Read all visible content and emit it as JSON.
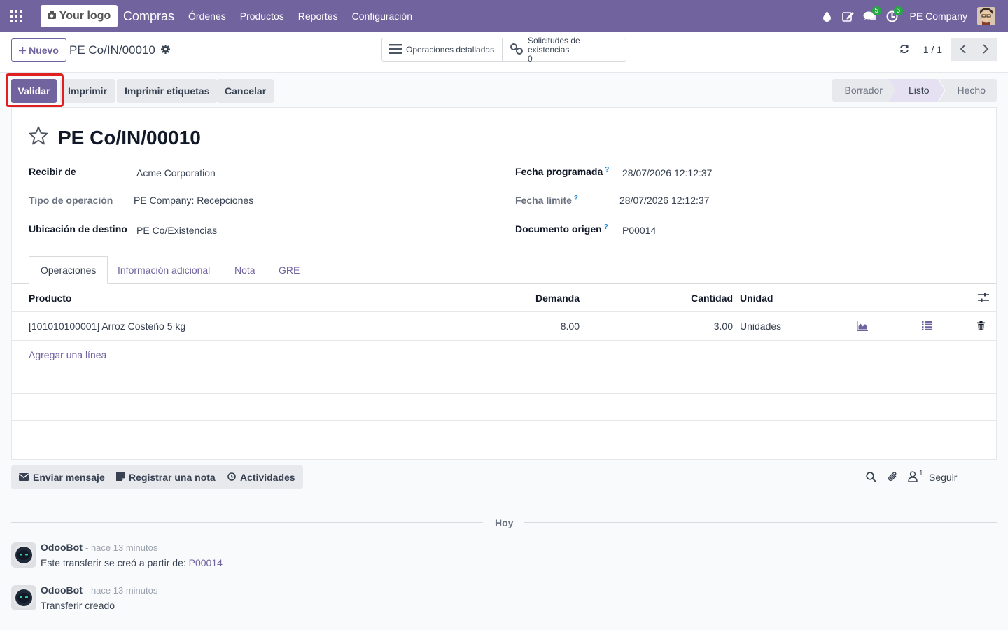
{
  "topbar": {
    "logo_label": "Your logo",
    "app_name": "Compras",
    "menu": [
      "Órdenes",
      "Productos",
      "Reportes",
      "Configuración"
    ],
    "messages_count": "5",
    "activities_count": "6",
    "company": "PE Company"
  },
  "control_panel": {
    "new_label": "Nuevo",
    "breadcrumb": "PE Co/IN/00010",
    "smart_buttons": [
      {
        "label": "Operaciones detalladas",
        "icon": "list-icon"
      },
      {
        "label": "Solicitudes de existencias",
        "value": "0",
        "icon": "link-icon"
      }
    ],
    "pager": "1 / 1"
  },
  "statusbar": {
    "buttons": [
      "Validar",
      "Imprimir",
      "Imprimir etiquetas",
      "Cancelar"
    ],
    "stages": [
      "Borrador",
      "Listo",
      "Hecho"
    ],
    "active_stage": "Listo"
  },
  "form": {
    "title": "PE Co/IN/00010",
    "fields": {
      "partner": {
        "label": "Recibir de",
        "value": "Acme Corporation"
      },
      "operation_type": {
        "label": "Tipo de operación",
        "value": "PE Company: Recepciones"
      },
      "dest_location": {
        "label": "Ubicación de destino",
        "value": "PE Co/Existencias"
      },
      "scheduled_date": {
        "label": "Fecha programada",
        "value": "28/07/2026 12:12:37"
      },
      "deadline": {
        "label": "Fecha límite",
        "value": "28/07/2026 12:12:37"
      },
      "origin": {
        "label": "Documento origen",
        "value": "P00014"
      }
    },
    "help_mark": "?",
    "tabs": [
      "Operaciones",
      "Información adicional",
      "Nota",
      "GRE"
    ],
    "table": {
      "columns": [
        "Producto",
        "Demanda",
        "Cantidad",
        "Unidad"
      ],
      "rows": [
        {
          "product": "[101010100001] Arroz Costeño 5 kg",
          "demand": "8.00",
          "quantity": "3.00",
          "uom": "Unidades"
        }
      ],
      "add_line": "Agregar una línea"
    }
  },
  "chatter": {
    "buttons": [
      "Enviar mensaje",
      "Registrar una nota",
      "Actividades"
    ],
    "followers_count": "1",
    "follow_label": "Seguir",
    "date_separator": "Hoy",
    "messages": [
      {
        "author": "OdooBot",
        "time": "- hace 13 minutos",
        "body": "Este transferir se creó a partir de: ",
        "link": "P00014"
      },
      {
        "author": "OdooBot",
        "time": "- hace 13 minutos",
        "body": "Transferir creado",
        "link": ""
      }
    ]
  },
  "colors": {
    "brand": "#71639e",
    "highlight": "#e02020",
    "badge": "#28a745"
  }
}
